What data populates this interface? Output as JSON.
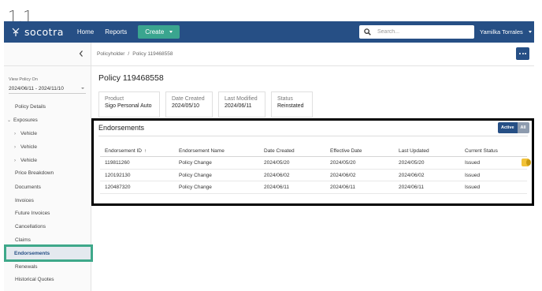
{
  "step": "1.1",
  "topbar": {
    "logo_text": "socotra",
    "nav": [
      "Home",
      "Reports"
    ],
    "create_label": "Create",
    "search_placeholder": "Search...",
    "user_name": "Yamilka Torrales"
  },
  "sidebar": {
    "view_label": "View Policy On",
    "date_range": "2024/06/11 - 2024/11/10",
    "items": [
      {
        "label": "Policy Details"
      },
      {
        "label": "Exposures"
      },
      {
        "label": "Vehicle"
      },
      {
        "label": "Vehicle"
      },
      {
        "label": "Vehicle"
      },
      {
        "label": "Price Breakdown"
      },
      {
        "label": "Documents"
      },
      {
        "label": "Invoices"
      },
      {
        "label": "Future Invoices"
      },
      {
        "label": "Cancellations"
      },
      {
        "label": "Claims"
      },
      {
        "label": "Endorsements"
      },
      {
        "label": "Renewals"
      },
      {
        "label": "Historical Quotes"
      }
    ]
  },
  "breadcrumb": [
    "Policyholder",
    "Policy 119468558"
  ],
  "policy_title": "Policy 119468558",
  "cards": [
    {
      "label": "Product",
      "value": "Sigo Personal Auto"
    },
    {
      "label": "Date Created",
      "value": "2024/05/10"
    },
    {
      "label": "Last Modified",
      "value": "2024/06/11"
    },
    {
      "label": "Status",
      "value": "Reinstated"
    }
  ],
  "endorsements": {
    "title": "Endorsements",
    "toggle": [
      "Active",
      "All"
    ],
    "columns": [
      "Endorsement ID",
      "Endorsement Name",
      "Date Created",
      "Effective Date",
      "Last Updated",
      "Current Status"
    ],
    "sort_arrow": "↑",
    "rows": [
      [
        "119811260",
        "Policy Change",
        "2024/05/20",
        "2024/05/20",
        "2024/05/20",
        "Issued"
      ],
      [
        "120192130",
        "Policy Change",
        "2024/06/02",
        "2024/06/02",
        "2024/06/02",
        "Issued"
      ],
      [
        "120487320",
        "Policy Change",
        "2024/06/11",
        "2024/06/11",
        "2024/06/11",
        "Issued"
      ]
    ]
  },
  "colors": {
    "topbar": "#264f85",
    "create_button": "#3aa58f",
    "highlight": "#3ea88a",
    "panel_border": "#000000"
  }
}
